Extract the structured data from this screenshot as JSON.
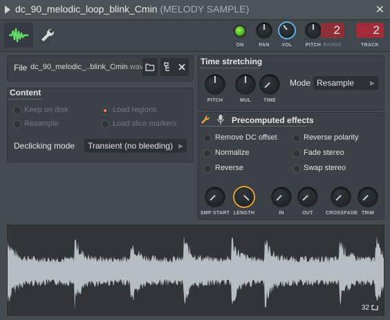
{
  "window": {
    "title": "dc_90_melodic_loop_blink_Cmin",
    "subtitle": "(MELODY SAMPLE)",
    "close": "✕"
  },
  "toolbar": {
    "on_label": "ON",
    "pan_label": "PAN",
    "vol_label": "VOL",
    "pitch_label": "PITCH",
    "range_label": "RANGE",
    "range_value": "2",
    "track_label": "TRACK",
    "track_value": "2",
    "on_state": true
  },
  "file": {
    "label": "File",
    "name": "dc_90_melodic_..blink_Cmin",
    "ext": ".wav"
  },
  "content": {
    "title": "Content",
    "options": [
      {
        "label": "Keep on disk",
        "selected": false
      },
      {
        "label": "Load regions",
        "selected": true
      },
      {
        "label": "Resample",
        "selected": false
      },
      {
        "label": "Load slice markers",
        "selected": false
      }
    ],
    "declicking_label": "Declicking mode",
    "declicking_value": "Transient (no bleeding)"
  },
  "time_stretching": {
    "title": "Time stretching",
    "knobs": [
      "PITCH",
      "MUL",
      "TIME"
    ],
    "mode_label": "Mode",
    "mode_value": "Resample"
  },
  "precomputed": {
    "title": "Precomputed effects",
    "options": [
      {
        "label": "Remove DC offset",
        "selected": false
      },
      {
        "label": "Reverse polarity",
        "selected": false
      },
      {
        "label": "Normalize",
        "selected": false
      },
      {
        "label": "Fade stereo",
        "selected": false
      },
      {
        "label": "Reverse",
        "selected": false
      },
      {
        "label": "Swap stereo",
        "selected": false
      }
    ],
    "knobs": [
      "SMP START",
      "LENGTH",
      "IN",
      "OUT",
      "CROSSFADE",
      "TRIM"
    ]
  },
  "waveform": {
    "zoom_value": "32"
  },
  "colors": {
    "accent_green": "#5ee06a",
    "accent_orange": "#e4a234",
    "accent_blue": "#5db6e6",
    "track_red": "#a02d37"
  },
  "icons": {
    "waveform_tab": "waveform-icon",
    "settings_tab": "wrench-icon",
    "open_file": "folder-icon",
    "locate_file": "folder-tree-icon",
    "remove_file": "close-icon",
    "effects_wrench": "wrench-icon",
    "effects_mic": "microphone-icon"
  }
}
